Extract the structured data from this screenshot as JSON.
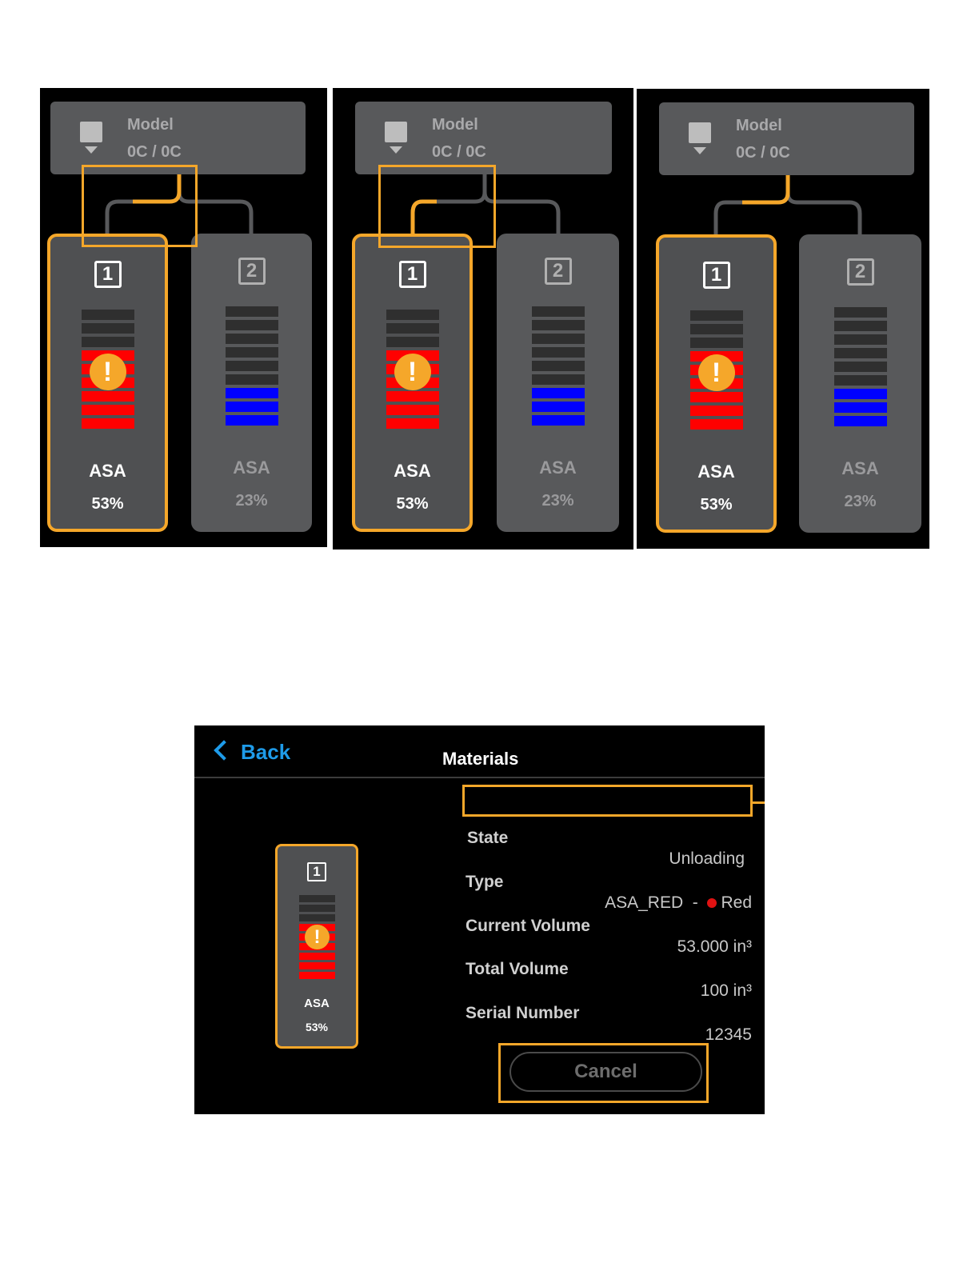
{
  "panels": [
    {
      "model_label": "Model",
      "model_temp": "0C / 0C",
      "bays": [
        {
          "number": "1",
          "material": "ASA",
          "percent": "53%",
          "active": true,
          "warning": true,
          "filled_segments": 6,
          "total_segments": 9,
          "fill_color": "#ff0000"
        },
        {
          "number": "2",
          "material": "ASA",
          "percent": "23%",
          "active": false,
          "warning": false,
          "filled_segments": 3,
          "total_segments": 9,
          "fill_color": "#0000ff"
        }
      ]
    },
    {
      "model_label": "Model",
      "model_temp": "0C / 0C",
      "bays": [
        {
          "number": "1",
          "material": "ASA",
          "percent": "53%",
          "active": true,
          "warning": true,
          "filled_segments": 6,
          "total_segments": 9,
          "fill_color": "#ff0000"
        },
        {
          "number": "2",
          "material": "ASA",
          "percent": "23%",
          "active": false,
          "warning": false,
          "filled_segments": 3,
          "total_segments": 9,
          "fill_color": "#0000ff"
        }
      ]
    },
    {
      "model_label": "Model",
      "model_temp": "0C / 0C",
      "bays": [
        {
          "number": "1",
          "material": "ASA",
          "percent": "53%",
          "active": true,
          "warning": true,
          "filled_segments": 6,
          "total_segments": 9,
          "fill_color": "#ff0000"
        },
        {
          "number": "2",
          "material": "ASA",
          "percent": "23%",
          "active": false,
          "warning": false,
          "filled_segments": 3,
          "total_segments": 9,
          "fill_color": "#0000ff"
        }
      ]
    }
  ],
  "detail": {
    "back_label": "Back",
    "title": "Materials",
    "bay": {
      "number": "1",
      "material": "ASA",
      "percent": "53%",
      "filled_segments": 6,
      "total_segments": 9,
      "fill_color": "#ff0000"
    },
    "fields": {
      "state_label": "State",
      "state_value": "Unloading",
      "type_label": "Type",
      "type_value": "ASA_RED",
      "type_sep": "-",
      "color_name": "Red",
      "current_volume_label": "Current Volume",
      "current_volume_value": "53.000 in³",
      "total_volume_label": "Total Volume",
      "total_volume_value": "100 in³",
      "serial_label": "Serial Number",
      "serial_value": "12345"
    },
    "cancel_label": "Cancel"
  },
  "colors": {
    "accent": "#f5a72a",
    "link": "#1e9be9",
    "panel_bg": "#000000",
    "card_bg": "#58595b",
    "empty_segment": "#2f2f2f"
  }
}
